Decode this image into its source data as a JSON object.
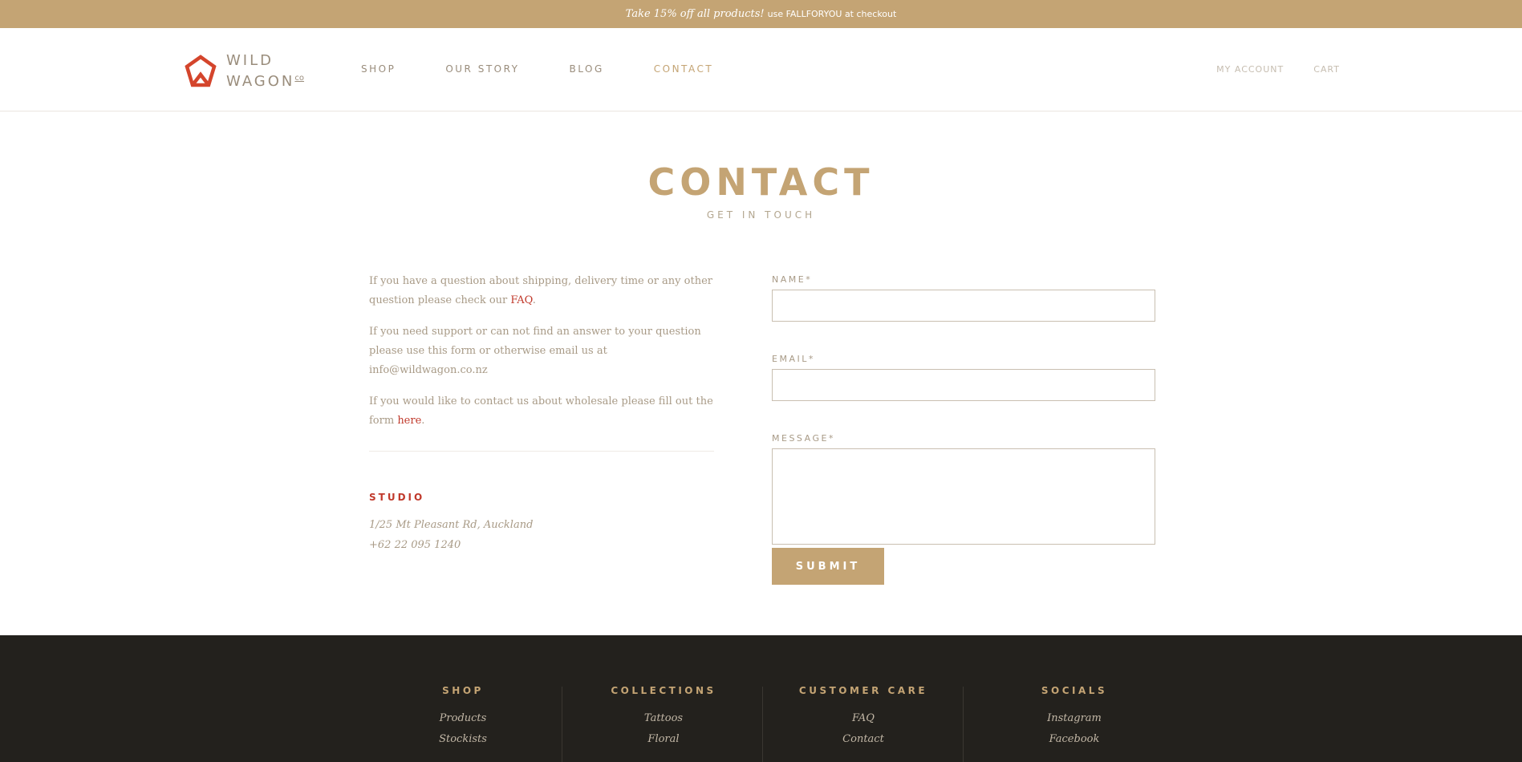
{
  "announcement": {
    "promo": "Take 15% off all products!",
    "code": "use FALLFORYOU at checkout"
  },
  "logo": {
    "line1": "WILD",
    "line2": "WAGON",
    "suffix": "co",
    "icon": "pentagon-logo-icon"
  },
  "nav": [
    "SHOP",
    "OUR STORY",
    "BLOG",
    "CONTACT"
  ],
  "account": {
    "my_account": "MY ACCOUNT",
    "cart": "CART"
  },
  "page": {
    "title": "CONTACT",
    "subtitle": "GET IN TOUCH"
  },
  "intro": {
    "p1_text": "If you have a question about shipping, delivery time or any other question please check our ",
    "p1_link": "FAQ",
    "p2": "If you need support or can not find an answer to your question please use this form or otherwise email us at info@wildwagon.co.nz",
    "p3_text": "If you would like to contact us about wholesale please fill out the form ",
    "p3_link": "here"
  },
  "studio": {
    "heading": "STUDIO",
    "address": "1/25 Mt Pleasant Rd, Auckland",
    "phone": "+62 22 095 1240"
  },
  "form": {
    "name_label": "NAME*",
    "email_label": "EMAIL*",
    "message_label": "MESSAGE*",
    "name_value": "",
    "email_value": "",
    "message_value": "",
    "submit": "SUBMIT"
  },
  "footer": {
    "columns": [
      {
        "heading": "SHOP",
        "links": [
          "Products",
          "Stockists"
        ]
      },
      {
        "heading": "COLLECTIONS",
        "links": [
          "Tattoos",
          "Floral"
        ]
      },
      {
        "heading": "CUSTOMER CARE",
        "links": [
          "FAQ",
          "Contact"
        ]
      },
      {
        "heading": "SOCIALS",
        "links": [
          "Instagram",
          "Facebook"
        ]
      }
    ]
  },
  "colors": {
    "accent": "#c4a474",
    "link": "#c0392b",
    "footer_bg": "#23211d",
    "logo_red": "#d4452c"
  }
}
